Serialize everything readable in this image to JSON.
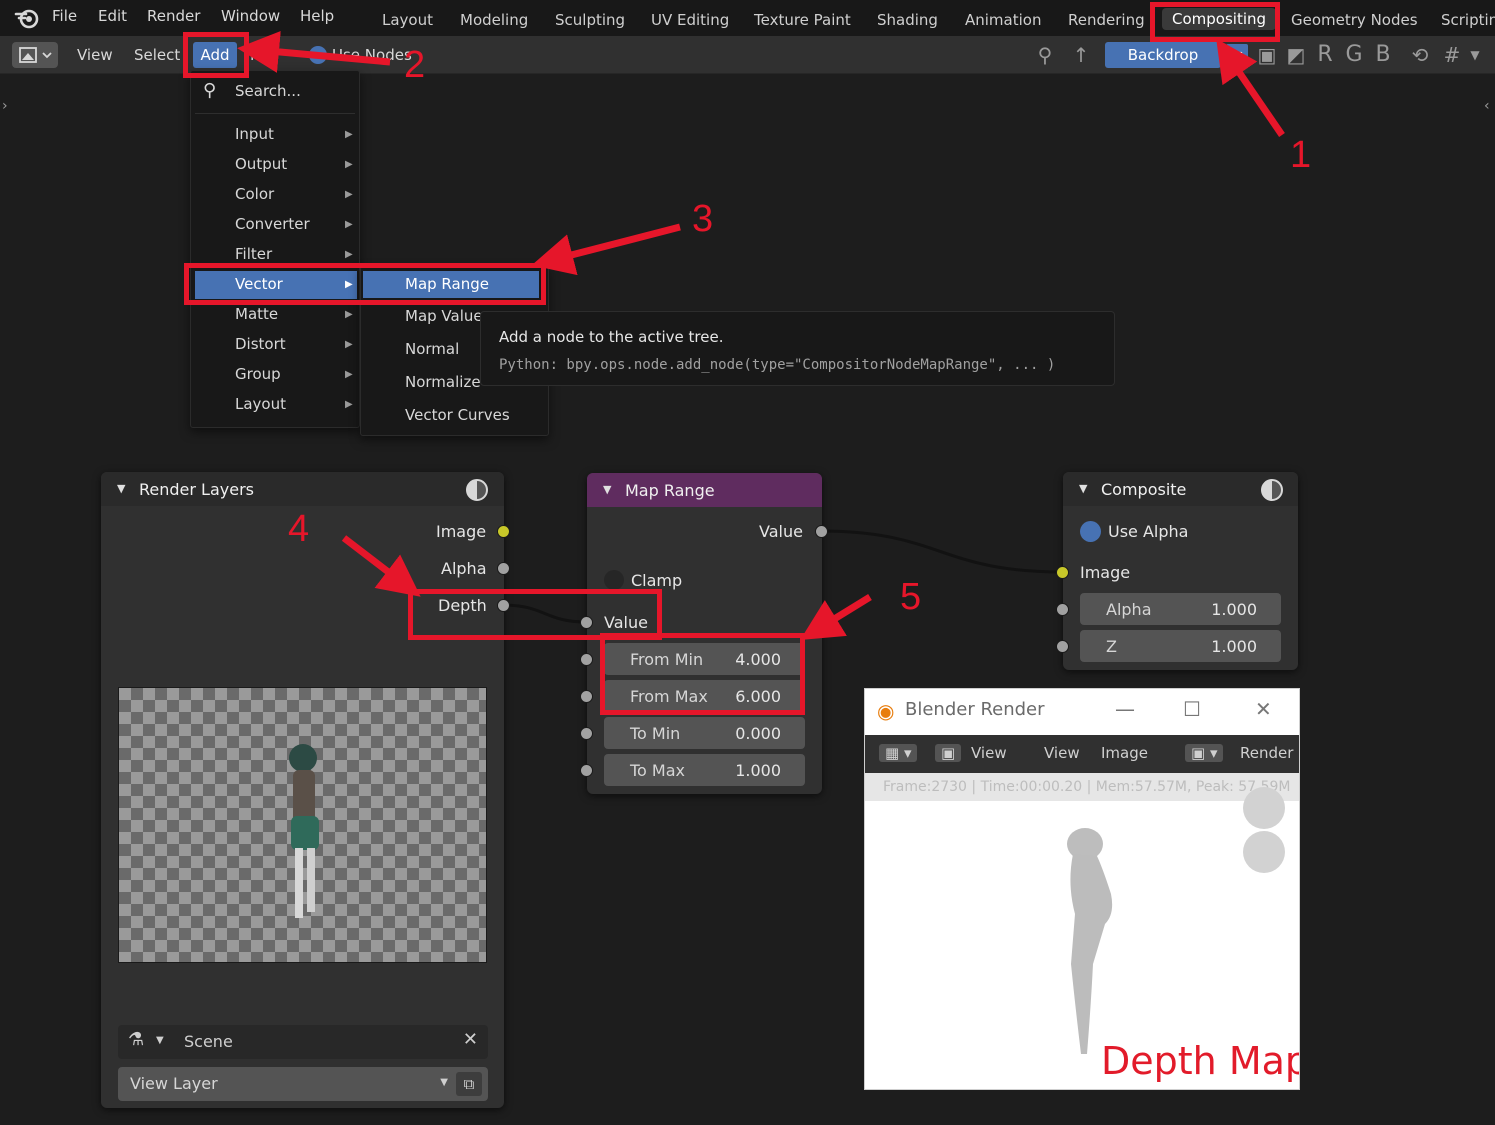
{
  "topbar": {
    "menus": [
      "File",
      "Edit",
      "Render",
      "Window",
      "Help"
    ],
    "workspaces": [
      "Layout",
      "Modeling",
      "Sculpting",
      "UV Editing",
      "Texture Paint",
      "Shading",
      "Animation",
      "Rendering",
      "Compositing",
      "Geometry Nodes",
      "Scriptin"
    ]
  },
  "header": {
    "view": "View",
    "select": "Select",
    "add": "Add",
    "node_partial": "N",
    "use_nodes": "Use Nodes",
    "backdrop": "Backdrop",
    "channels": [
      "R",
      "G",
      "B"
    ]
  },
  "add_menu": {
    "search": "Search...",
    "items": [
      "Input",
      "Output",
      "Color",
      "Converter",
      "Filter",
      "Vector",
      "Matte",
      "Distort",
      "Group",
      "Layout"
    ]
  },
  "vector_submenu": {
    "items": [
      "Map Range",
      "Map Value",
      "Normal",
      "Normalize",
      "Vector Curves"
    ]
  },
  "tooltip": {
    "description": "Add a node to the active tree.",
    "python": "Python: bpy.ops.node.add_node(type=\"CompositorNodeMapRange\", ... )"
  },
  "render_layers_node": {
    "title": "Render Layers",
    "outputs": [
      "Image",
      "Alpha",
      "Depth"
    ],
    "scene": "Scene",
    "view_layer": "View Layer"
  },
  "map_range_node": {
    "title": "Map Range",
    "output": "Value",
    "clamp": "Clamp",
    "input_value": "Value",
    "fields": [
      {
        "label": "From Min",
        "value": "4.000"
      },
      {
        "label": "From Max",
        "value": "6.000"
      },
      {
        "label": "To Min",
        "value": "0.000"
      },
      {
        "label": "To Max",
        "value": "1.000"
      }
    ],
    "header_color": "#5f2c5f"
  },
  "composite_node": {
    "title": "Composite",
    "use_alpha": "Use Alpha",
    "image": "Image",
    "fields": [
      {
        "label": "Alpha",
        "value": "1.000"
      },
      {
        "label": "Z",
        "value": "1.000"
      }
    ]
  },
  "render_window": {
    "title": "Blender Render",
    "menu": [
      "View",
      "View",
      "Image",
      "Render R"
    ],
    "stats": "Frame:2730 | Time:00:00.20 | Mem:57.57M, Peak: 57.59M",
    "overlay_label": "Depth Map"
  },
  "annotations": [
    "1",
    "2",
    "3",
    "4",
    "5"
  ],
  "colors": {
    "accent": "#4772b3",
    "annotation": "#e6162a",
    "socket_yellow": "#c7c729"
  }
}
